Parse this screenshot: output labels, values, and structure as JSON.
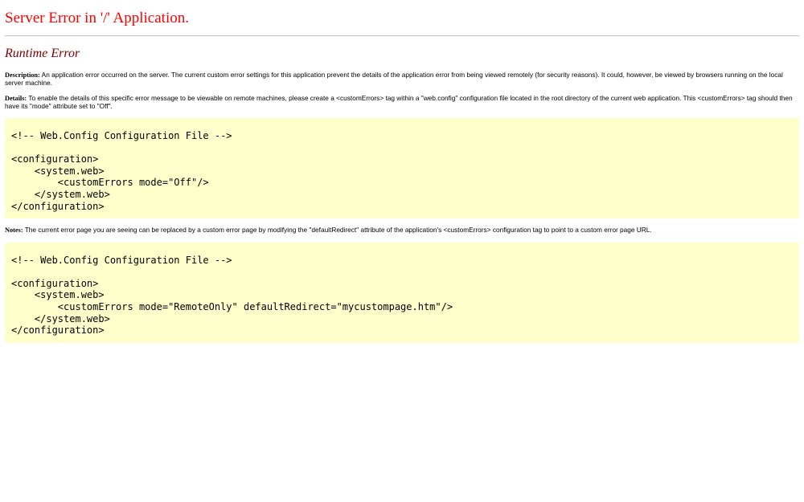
{
  "page": {
    "title": "Server Error in '/' Application.",
    "subtitle": "Runtime Error"
  },
  "description": {
    "label": "Description:",
    "text": "An application error occurred on the server. The current custom error settings for this application prevent the details of the application error from being viewed remotely (for security reasons). It could, however, be viewed by browsers running on the local server machine."
  },
  "details": {
    "label": "Details:",
    "text": "To enable the details of this specific error message to be viewable on remote machines, please create a <customErrors> tag within a \"web.config\" configuration file located in the root directory of the current web application. This <customErrors> tag should then have its \"mode\" attribute set to \"Off\".",
    "code": "<!-- Web.Config Configuration File -->\n\n<configuration>\n    <system.web>\n        <customErrors mode=\"Off\"/>\n    </system.web>\n</configuration>"
  },
  "notes": {
    "label": "Notes:",
    "text": "The current error page you are seeing can be replaced by a custom error page by modifying the \"defaultRedirect\" attribute of the application's <customErrors> configuration tag to point to a custom error page URL.",
    "code": "<!-- Web.Config Configuration File -->\n\n<configuration>\n    <system.web>\n        <customErrors mode=\"RemoteOnly\" defaultRedirect=\"mycustompage.htm\"/>\n    </system.web>\n</configuration>"
  },
  "colors": {
    "title": "#ff0000",
    "subtitle": "#800000",
    "code_background": "#ffffcc",
    "rule": "#c0c0c0"
  }
}
